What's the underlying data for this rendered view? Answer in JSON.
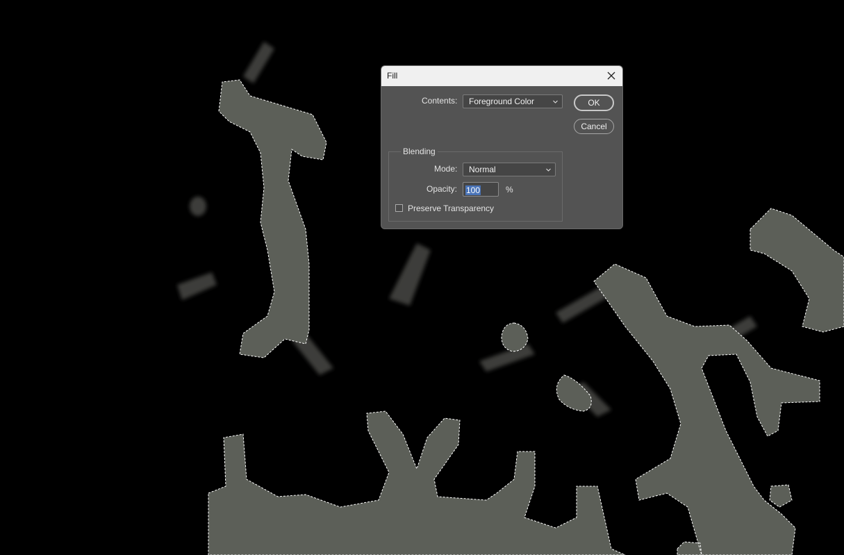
{
  "dialog": {
    "title": "Fill",
    "contents_label": "Contents:",
    "contents_value": "Foreground Color",
    "ok_label": "OK",
    "cancel_label": "Cancel",
    "blending_title": "Blending",
    "mode_label": "Mode:",
    "mode_value": "Normal",
    "opacity_label": "Opacity:",
    "opacity_value": "100",
    "opacity_unit": "%",
    "preserve_label": "Preserve Transparency",
    "preserve_checked": false
  },
  "colors": {
    "canvas_bg": "#000000",
    "branch_fill": "#5c5f58",
    "selection_outline": "#ffffff",
    "dialog_bg": "#535353",
    "titlebar_bg": "#f0f0f0",
    "highlight": "#4a74b8"
  },
  "icons": [
    "close-icon",
    "chevron-down-icon"
  ]
}
